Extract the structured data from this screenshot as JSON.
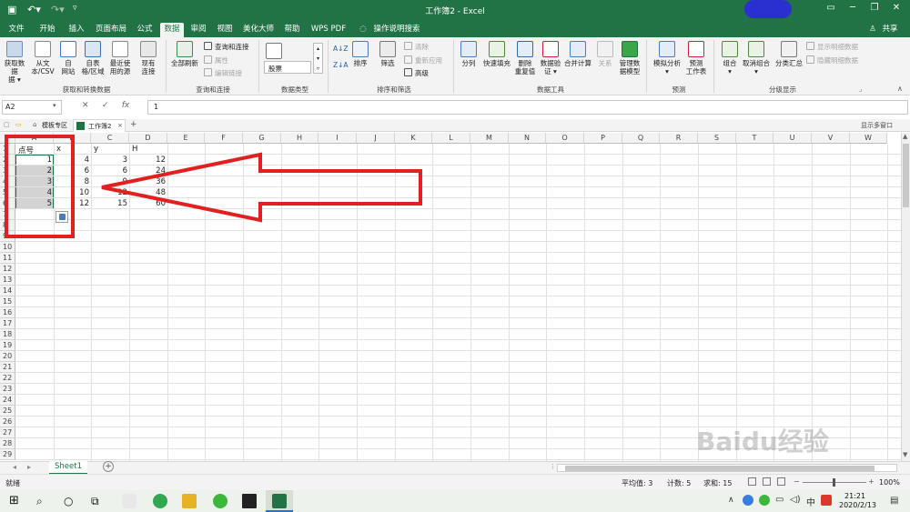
{
  "window": {
    "title": "工作簿2 - Excel",
    "share_label": "共享",
    "minimize": "─",
    "restore": "❐",
    "close": "✕"
  },
  "ribbon_tabs": [
    "文件",
    "开始",
    "插入",
    "页面布局",
    "公式",
    "数据",
    "审阅",
    "视图",
    "美化大师",
    "帮助",
    "WPS PDF",
    "操作说明搜索"
  ],
  "active_tab": "数据",
  "ribbon": {
    "get_data": "获取数据",
    "get_data_arrow": "据 ▾",
    "from_csv_1": "从文",
    "from_csv_2": "本/CSV",
    "from_web_1": "自",
    "from_web_2": "网站",
    "from_table_1": "自表",
    "from_table_2": "格/区域",
    "recent_1": "最近使",
    "recent_2": "用的源",
    "existing_1": "现有",
    "existing_2": "连接",
    "group_get": "获取和转换数据",
    "refresh_all": "全部刷新",
    "queries": "查询和连接",
    "properties": "属性",
    "edit_links": "编辑链接",
    "group_queries": "查询和连接",
    "stocks": "股票",
    "group_types": "数据类型",
    "sort": "排序",
    "filter": "筛选",
    "clear": "清除",
    "reapply": "重新应用",
    "advanced": "高级",
    "group_sort": "排序和筛选",
    "text_to_col": "分列",
    "flash_fill": "快速填充",
    "remove_dup_1": "删除",
    "remove_dup_2": "重复值",
    "validation_1": "数据验",
    "validation_2": "证 ▾",
    "consolidate": "合并计算",
    "relations": "关系",
    "data_model_1": "管理数",
    "data_model_2": "据模型",
    "group_tools": "数据工具",
    "what_if": "模拟分析",
    "forecast_1": "预测",
    "forecast_2": "工作表",
    "group_forecast": "预测",
    "group_btn": "组合",
    "ungroup": "取消组合",
    "subtotal": "分类汇总",
    "show_detail": "显示明细数据",
    "hide_detail": "隐藏明细数据",
    "group_outline": "分级显示"
  },
  "formula_bar": {
    "name_box": "A2",
    "cancel": "✕",
    "enter": "✓",
    "fx": "fx",
    "content": "1"
  },
  "doc_tabs": {
    "template": "模板专区",
    "workbook": "工作簿2",
    "add": "+",
    "multi_window": "显示多窗口"
  },
  "columns": [
    "A",
    "B",
    "C",
    "D",
    "E",
    "F",
    "G",
    "H",
    "I",
    "J",
    "K",
    "L",
    "M",
    "N",
    "O",
    "P",
    "Q",
    "R",
    "S",
    "T",
    "U",
    "V",
    "W"
  ],
  "rows": [
    "1",
    "2",
    "3",
    "4",
    "5",
    "6",
    "7",
    "8",
    "9",
    "10",
    "11",
    "12",
    "13",
    "14",
    "15",
    "16",
    "17",
    "18",
    "19",
    "20",
    "21",
    "22",
    "23",
    "24",
    "25",
    "26",
    "27",
    "28",
    "29"
  ],
  "cells": {
    "A1": "点号",
    "B1": "x",
    "C1": "y",
    "D1": "H",
    "A2": "1",
    "A3": "2",
    "A4": "3",
    "A5": "4",
    "A6": "5",
    "B2": "4",
    "B3": "6",
    "B4": "8",
    "B5": "10",
    "B6": "12",
    "C2": "3",
    "C3": "6",
    "C4": "9",
    "C5": "12",
    "C6": "15",
    "D2": "12",
    "D3": "24",
    "D4": "36",
    "D5": "48",
    "D6": "60"
  },
  "sheet": {
    "active": "Sheet1",
    "add": "+"
  },
  "status": {
    "ready": "就绪",
    "average": "平均值: 3",
    "count": "计数: 5",
    "sum": "求和: 15",
    "zoom": "100%"
  },
  "clock": {
    "time": "21:21",
    "date": "2020/2/13"
  },
  "watermark": "Baidu经验",
  "accent": "#217346",
  "highlight": "#e32020"
}
